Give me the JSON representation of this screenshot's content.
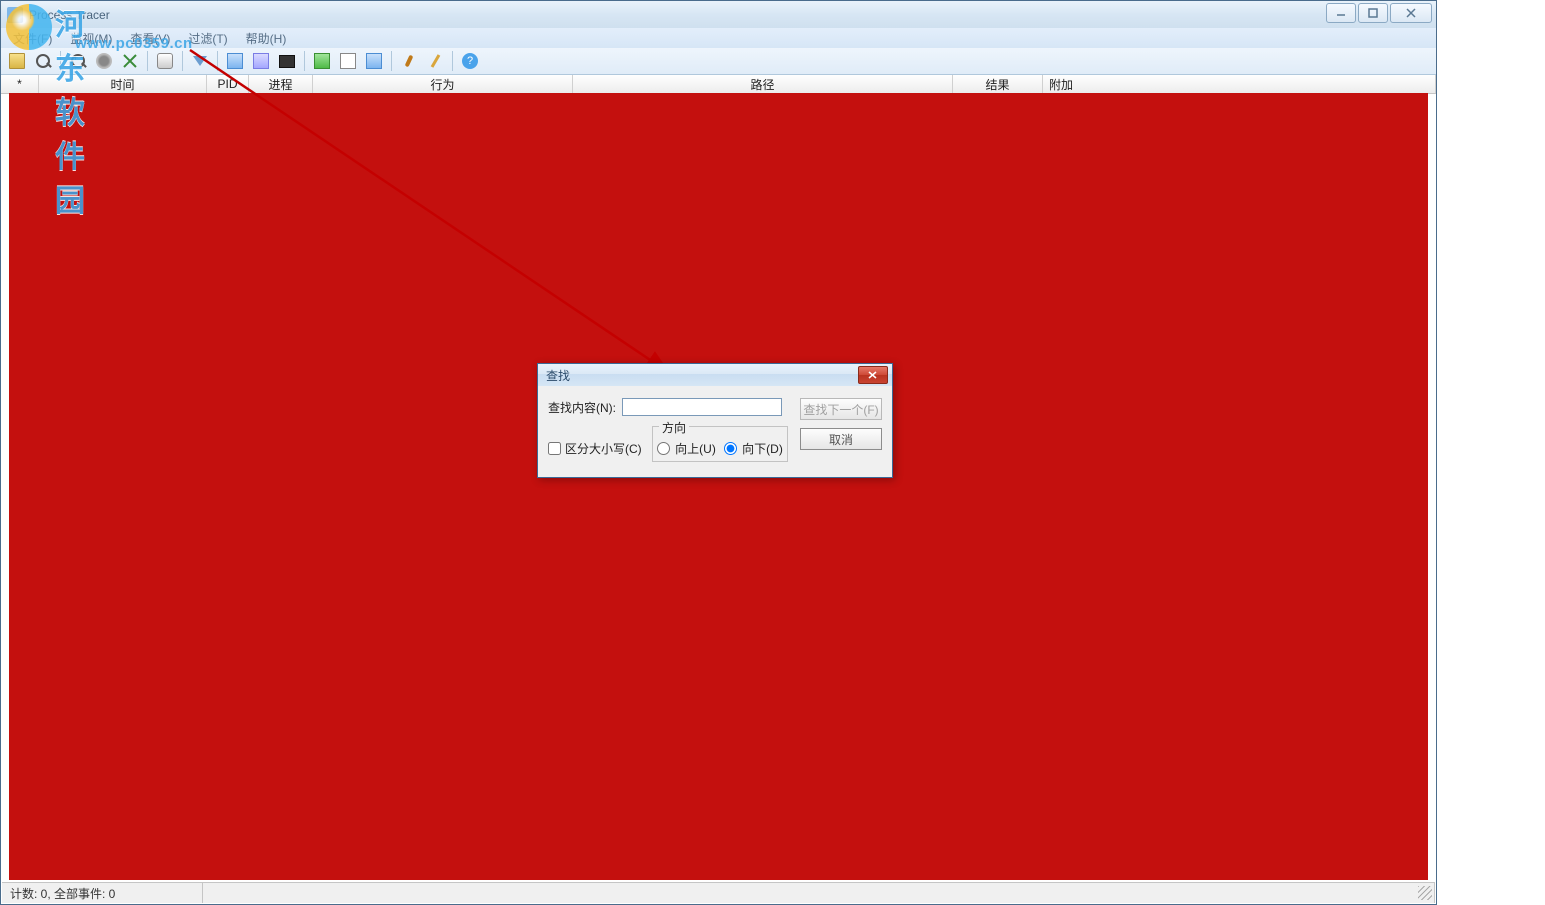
{
  "window": {
    "title": "Process Tracer"
  },
  "menu": {
    "file": "文件(F)",
    "monitor": "监视(M)",
    "view": "查看(V)",
    "filter": "过滤(T)",
    "help": "帮助(H)"
  },
  "columns": {
    "star": "*",
    "time": "时间",
    "pid": "PID",
    "process": "进程",
    "behavior": "行为",
    "path": "路径",
    "result": "结果",
    "extra": "附加"
  },
  "status": {
    "text": "计数: 0, 全部事件: 0"
  },
  "watermark": {
    "name": "河东软件园",
    "url": "www.pc0359.cn"
  },
  "find_dialog": {
    "title": "查找",
    "content_label": "查找内容(N):",
    "input_value": "",
    "find_next": "查找下一个(F)",
    "cancel": "取消",
    "direction_label": "方向",
    "up": "向上(U)",
    "down": "向下(D)",
    "case_sensitive": "区分大小写(C)"
  }
}
